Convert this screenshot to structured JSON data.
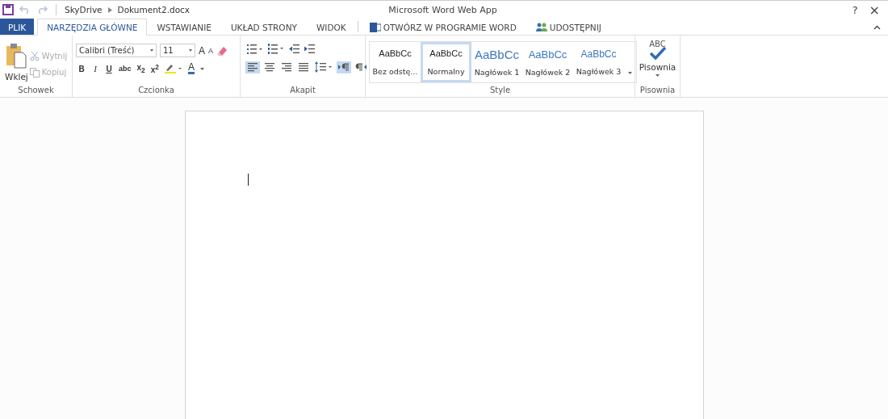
{
  "window": {
    "title": "Microsoft Word Web App",
    "breadcrumb": [
      "SkyDrive",
      "Dokument2.docx"
    ],
    "help": "?",
    "close": "×"
  },
  "tabs": [
    {
      "label": "PLIK",
      "kind": "file",
      "selected": false
    },
    {
      "label": "NARZĘDZIA GŁÓWNE",
      "kind": "tab",
      "selected": true
    },
    {
      "label": "WSTAWIANIE",
      "kind": "tab",
      "selected": false
    },
    {
      "label": "UKŁAD STRONY",
      "kind": "tab",
      "selected": false
    },
    {
      "label": "WIDOK",
      "kind": "tab",
      "selected": false
    },
    {
      "label": "OTWÓRZ W PROGRAMIE WORD",
      "kind": "word",
      "selected": false
    },
    {
      "label": "UDOSTĘPNIJ",
      "kind": "share",
      "selected": false
    }
  ],
  "clipboard": {
    "paste": "Wklej",
    "cut": {
      "label": "Wytnij",
      "disabled": true
    },
    "copy": {
      "label": "Kopiuj",
      "disabled": true
    },
    "group": "Schowek"
  },
  "font": {
    "family": "Calibri (Treść)",
    "size": "11",
    "grow": "A",
    "shrink": "A",
    "format": [
      {
        "label": "B",
        "kind": "bold"
      },
      {
        "label": "I",
        "kind": "italic"
      },
      {
        "label": "U",
        "kind": "underline"
      },
      {
        "label": "abc",
        "kind": "strike"
      },
      {
        "label": "x$_{2}$",
        "kind": "sub"
      },
      {
        "label": "x$^{2}$",
        "kind": "sup"
      }
    ],
    "color_label": "A",
    "group": "Czcionka"
  },
  "paragraph": {
    "group": "Akapit",
    "buttons": [
      {
        "kind": "align-left",
        "selected": true
      },
      {
        "kind": "align-center",
        "selected": false
      },
      {
        "kind": "align-right",
        "selected": false
      },
      {
        "kind": "justify",
        "selected": false
      },
      {
        "kind": "spacing",
        "selected": false
      },
      {
        "kind": "ltr",
        "selected": true
      },
      {
        "kind": "rtl",
        "selected": false
      }
    ]
  },
  "styles": {
    "group": "Style",
    "items": [
      {
        "preview": "AaBbCc",
        "label": "Bez odstę...",
        "kind": "plain",
        "selected": false
      },
      {
        "preview": "AaBbCc",
        "label": "Normalny",
        "kind": "plain",
        "selected": true
      },
      {
        "preview": "AaBbCc",
        "label": "Nagłówek 1",
        "kind": "h1",
        "selected": false
      },
      {
        "preview": "AaBbCc",
        "label": "Nagłówek 2",
        "kind": "h2",
        "selected": false
      },
      {
        "preview": "AaBbCc",
        "label": "Nagłówek 3",
        "kind": "h3",
        "selected": false
      }
    ]
  },
  "spelling": {
    "abc": "ABC",
    "label": "Pisownia",
    "group": "Pisownia"
  }
}
